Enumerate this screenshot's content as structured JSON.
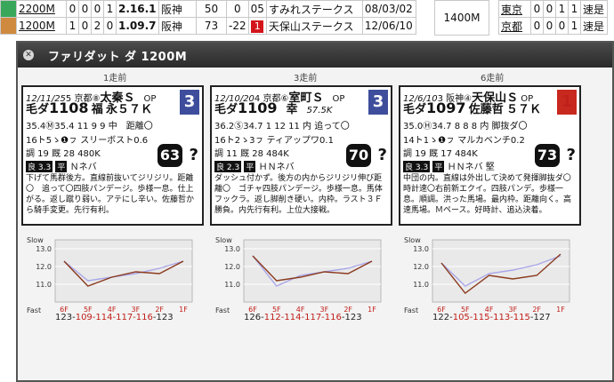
{
  "background": {
    "rows": [
      {
        "dist": "2200M",
        "stats": [
          "0",
          "0",
          "0",
          "1"
        ],
        "time": "2.16.1",
        "track": "阪神",
        "v1": "50",
        "v2": "0",
        "v3": "05",
        "race": "すみれステークス",
        "date": "08/03/02",
        "color": "#39a75a"
      },
      {
        "dist": "1200M",
        "stats": [
          "1",
          "0",
          "2",
          "0"
        ],
        "time": "1.09.7",
        "track": "阪神",
        "v1": "73",
        "v2": "-22",
        "rank": "1",
        "race": "天保山ステークス",
        "date": "12/06/10",
        "color": "#cf8a40"
      }
    ],
    "right_dist": "1400M",
    "right_rows": [
      {
        "track": "東京",
        "stats": [
          "0",
          "0",
          "1",
          "1"
        ],
        "extra": "速是"
      },
      {
        "track": "京都",
        "stats": [
          "0",
          "0",
          "0",
          "1"
        ],
        "extra": "速是"
      }
    ]
  },
  "dialog": {
    "title": "ファリダット ダ 1200M",
    "headers": [
      "1走前",
      "3走前",
      "6走前"
    ],
    "cards": [
      {
        "header_left": "12/11/25",
        "header_course": "5 京都⑧",
        "race_name": "太秦Ｓ",
        "grade": "OP",
        "frame": "3",
        "surface": "毛ダ",
        "time": "1108",
        "jockey": "福",
        "weight_info": "永５７Ｋ",
        "line3": "35.4Ⓜ35.4 11 9 9 中　距離〇",
        "line4": "16ト5ゝ❶ㇷ スリーボスト0.6",
        "line5": "調 19 厩 28 480K",
        "track": "良 3.3",
        "flat": "平",
        "baba": "Ｎネバ",
        "score": "63",
        "q": "?",
        "comment": "下げて馬群後方。直線前抜いてジリジリ。距離〇　追って〇四肢パンデージ。歩様一息。仕上がる。返し蹴り弱い。アテにし辛い。佐藤哲から騎手変更。先行有利。"
      },
      {
        "header_left": "12/10/20",
        "header_course": "4 京都⑥",
        "race_name": "室町Ｓ",
        "grade": "OP",
        "frame": "3",
        "surface": "毛ダ",
        "time": "1109",
        "jockey": "幸",
        "weight_info": "57.5K",
        "line3": "36.2Ⓢ34.7 1 12 11 内 追って〇",
        "line4": "16ト2ゝ3ㇷ ティアップワ0.1",
        "line5": "調 11 厩 28 484K",
        "track": "良 2.3",
        "flat": "平",
        "baba": "ＨＮネバ",
        "score": "70",
        "q": "?",
        "comment": "ダッシュ付かず。後方の内からジリジリ伸び距離〇　ゴチャ四肢パンデージ。歩様一息。馬体フックラ。返し脚削き硬い。内枠。ラスト３Ｆ勝負。内先行有利。上位大接戦。"
      },
      {
        "header_left": "12/6/10",
        "header_course": "3 阪神④",
        "race_name": "天保山Ｓ",
        "grade": "OP",
        "frame": "1",
        "surface": "毛ダ",
        "time": "1097",
        "jockey": "佐藤哲",
        "weight_info": "５７Ｋ",
        "line3": "35.0Ⓗ34.7 8 8 8 内 脚抜ダ〇",
        "line4": "14ト1ゝ❶ㇷ マルカベンチ0.2",
        "line5": "調 19 厩 17 484K",
        "track": "良 3.3",
        "flat": "平",
        "baba": "ＨＮネバ 堅",
        "score": "73",
        "q": "?",
        "comment": "中団の内。直線は外出して決めて発揮脚抜ダ〇　時計速〇右前新エクイ。四肢パンデ。歩様一息。順調。洪った馬場。最内枠。距離向く。高速馬場。Ｍペース。好時計、追込決着。"
      }
    ],
    "charts": [
      {
        "labels": [
          "6F",
          "5F",
          "4F",
          "3F",
          "2F",
          "1F"
        ],
        "actual": [
          12.3,
          10.9,
          11.4,
          11.7,
          11.6,
          12.3
        ],
        "average": [
          12.3,
          11.2,
          11.4,
          11.6,
          11.9,
          12.3
        ],
        "text_pre": "123-",
        "text_red": "109-114-117-116",
        "text_post": "-123"
      },
      {
        "labels": [
          "6F",
          "5F",
          "4F",
          "3F",
          "2F",
          "1F"
        ],
        "actual": [
          12.6,
          11.2,
          11.4,
          11.7,
          11.6,
          12.3
        ],
        "average": [
          12.6,
          10.9,
          11.5,
          11.7,
          11.9,
          12.3
        ],
        "text_pre": "126-",
        "text_red": "112-114-117-116",
        "text_post": "-123"
      },
      {
        "labels": [
          "6F",
          "5F",
          "4F",
          "3F",
          "2F",
          "1F"
        ],
        "actual": [
          12.2,
          10.5,
          11.5,
          11.3,
          11.5,
          12.7
        ],
        "average": [
          12.2,
          10.9,
          11.6,
          11.8,
          12.1,
          12.6
        ],
        "text_pre": "122-",
        "text_red": "105-115-113-115",
        "text_post": "-127"
      }
    ],
    "axis": {
      "slow": "Slow",
      "fast": "Fast",
      "ticks": [
        "13.0",
        "12.0",
        "11.0"
      ]
    }
  }
}
